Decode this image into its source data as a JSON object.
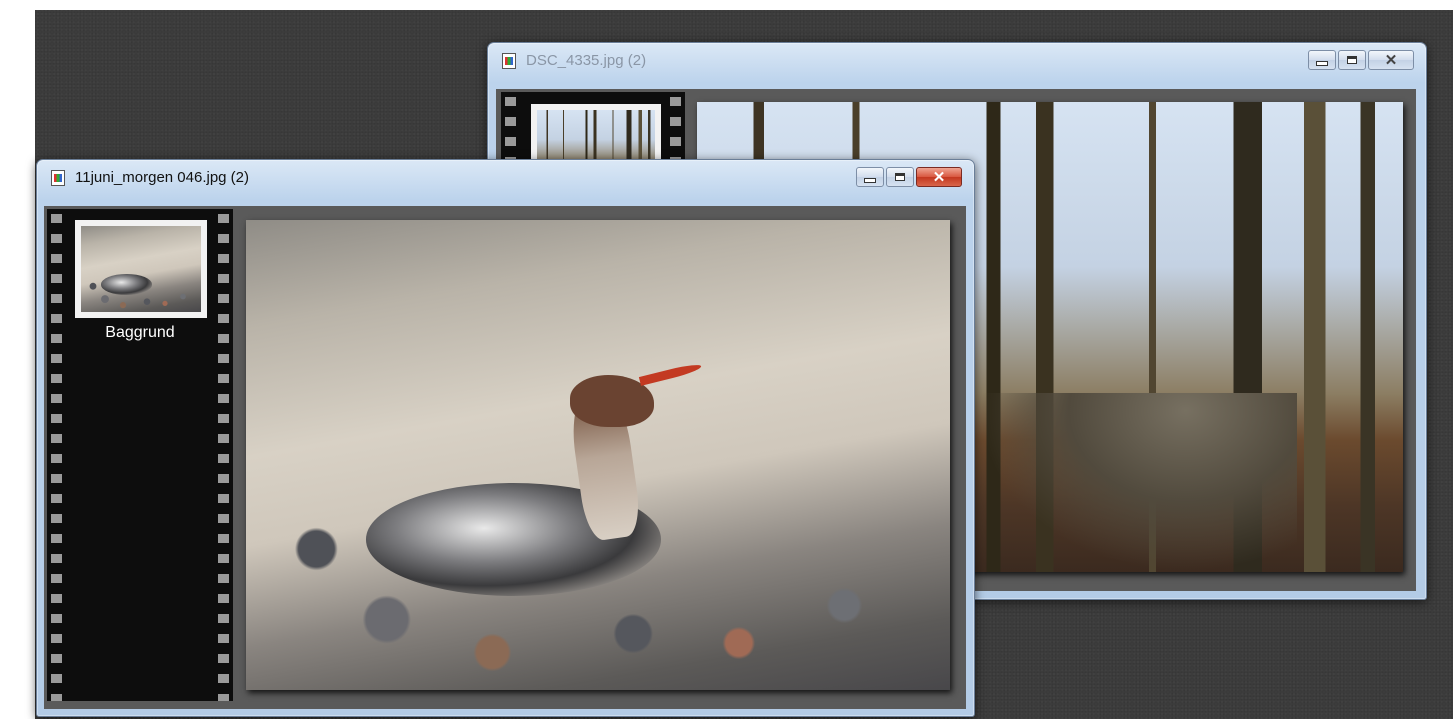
{
  "windows": [
    {
      "id": "dsc",
      "title": "DSC_4335.jpg (2)",
      "active": false,
      "buttons": {
        "minimize": "minimize",
        "maximize": "maximize",
        "close": "close"
      }
    },
    {
      "id": "morgen",
      "title": "11juni_morgen 046.jpg (2)",
      "active": true,
      "layers": [
        {
          "label": "Baggrund"
        }
      ],
      "buttons": {
        "minimize": "minimize",
        "maximize": "maximize",
        "close": "close"
      }
    }
  ],
  "icons": {
    "document": "image-document-icon",
    "minimize": "minimize-icon",
    "maximize": "maximize-icon",
    "close": "close-icon"
  },
  "colors": {
    "close_active": "#c3371f",
    "titlebar": "#bcd3ec",
    "filmstrip": "#0d0d0d",
    "workspace": "#3c3c3c"
  }
}
